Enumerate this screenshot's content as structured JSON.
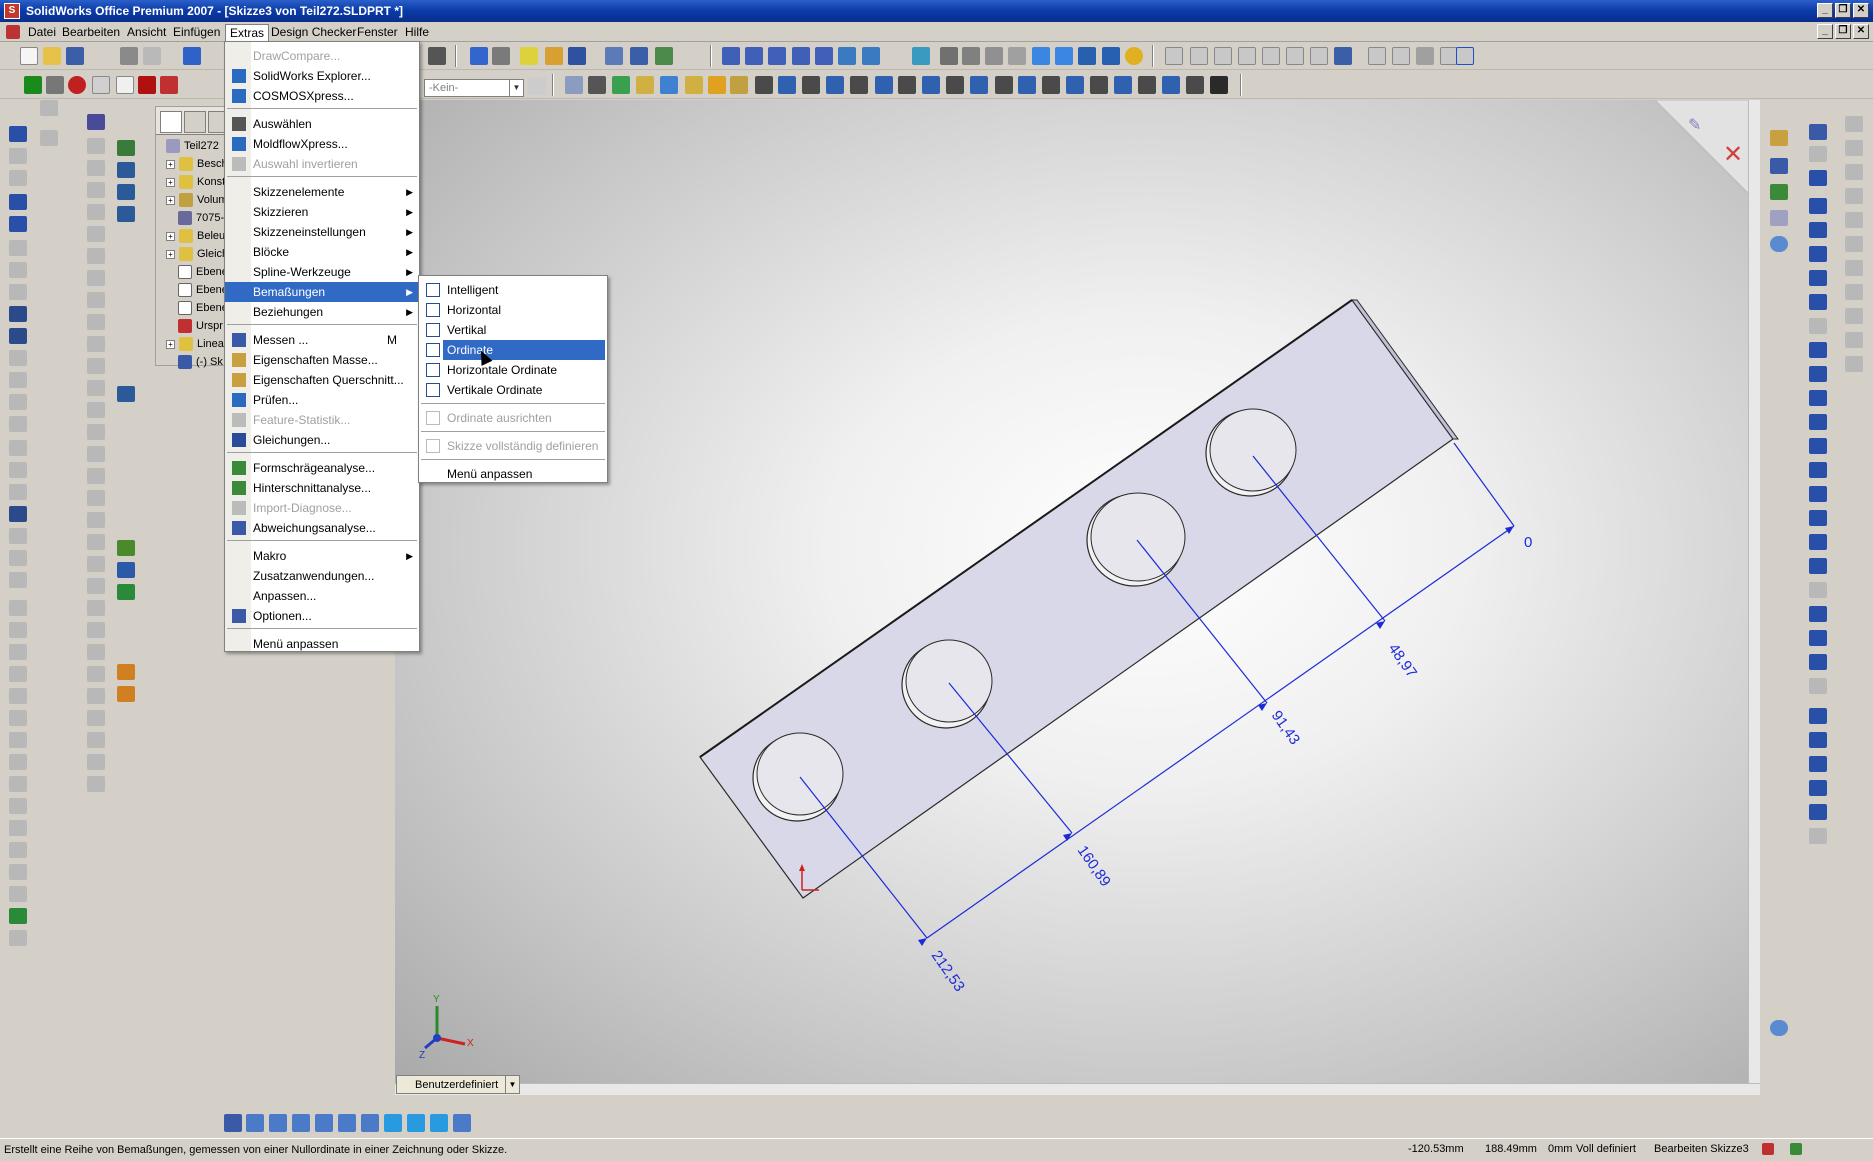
{
  "window": {
    "title": "SolidWorks Office Premium 2007 - [Skizze3 von Teil272.SLDPRT *]",
    "buttons": [
      "_",
      "❐",
      "✕"
    ]
  },
  "menubar": {
    "items": [
      "Datei",
      "Bearbeiten",
      "Ansicht",
      "Einfügen",
      "Extras",
      "Design Checker",
      "Fenster",
      "Hilfe"
    ],
    "active": "Extras"
  },
  "toolbar": {
    "config_dropdown": "-Kein-"
  },
  "feature_tree": {
    "root": "Teil272",
    "items": [
      "Besch",
      "Konst",
      "Volum",
      "7075-",
      "Beleu",
      "Gleich",
      "Ebene",
      "Ebene",
      "Ebene",
      "Urspr",
      "Linea",
      "(-) Sk"
    ]
  },
  "extras_menu": {
    "items": [
      {
        "label": "DrawCompare...",
        "disabled": true
      },
      {
        "label": "SolidWorks Explorer...",
        "disabled": false
      },
      {
        "label": "COSMOSXpress...",
        "disabled": false
      },
      {
        "label": "Auswählen",
        "disabled": false
      },
      {
        "label": "MoldflowXpress...",
        "disabled": false
      },
      {
        "label": "Auswahl invertieren",
        "disabled": true
      },
      {
        "label": "Skizzenelemente",
        "disabled": false,
        "submenu": true
      },
      {
        "label": "Skizzieren",
        "disabled": false,
        "submenu": true
      },
      {
        "label": "Skizzeneinstellungen",
        "disabled": false,
        "submenu": true
      },
      {
        "label": "Blöcke",
        "disabled": false,
        "submenu": true
      },
      {
        "label": "Spline-Werkzeuge",
        "disabled": false,
        "submenu": true
      },
      {
        "label": "Bemaßungen",
        "disabled": false,
        "submenu": true,
        "highlight": true
      },
      {
        "label": "Beziehungen",
        "disabled": false,
        "submenu": true
      },
      {
        "label": "Messen ...",
        "disabled": false,
        "shortcut": "M"
      },
      {
        "label": "Eigenschaften Masse...",
        "disabled": false
      },
      {
        "label": "Eigenschaften Querschnitt...",
        "disabled": false
      },
      {
        "label": "Prüfen...",
        "disabled": false
      },
      {
        "label": "Feature-Statistik...",
        "disabled": true
      },
      {
        "label": "Gleichungen...",
        "disabled": false
      },
      {
        "label": "Formschrägeanalyse...",
        "disabled": false
      },
      {
        "label": "Hinterschnittanalyse...",
        "disabled": false
      },
      {
        "label": "Import-Diagnose...",
        "disabled": true
      },
      {
        "label": "Abweichungsanalyse...",
        "disabled": false
      },
      {
        "label": "Makro",
        "disabled": false,
        "submenu": true
      },
      {
        "label": "Zusatzanwendungen...",
        "disabled": false
      },
      {
        "label": "Anpassen...",
        "disabled": false
      },
      {
        "label": "Optionen...",
        "disabled": false
      },
      {
        "label": "Menü anpassen",
        "disabled": false
      }
    ]
  },
  "dimensions_submenu": {
    "items": [
      {
        "label": "Intelligent",
        "disabled": false
      },
      {
        "label": "Horizontal",
        "disabled": false
      },
      {
        "label": "Vertikal",
        "disabled": false
      },
      {
        "label": "Ordinate",
        "disabled": false,
        "highlight": true
      },
      {
        "label": "Horizontale Ordinate",
        "disabled": false
      },
      {
        "label": "Vertikale Ordinate",
        "disabled": false
      },
      {
        "label": "Ordinate ausrichten",
        "disabled": true
      },
      {
        "label": "Skizze vollständig definieren",
        "disabled": true
      },
      {
        "label": "Menü anpassen",
        "disabled": false
      }
    ]
  },
  "viewport": {
    "dimensions": [
      "0",
      "48,97",
      "91,43",
      "160,89",
      "212,53"
    ],
    "view_orientation": "Benutzerdefiniert",
    "triad": {
      "x": "X",
      "y": "Y",
      "z": "Z"
    }
  },
  "statusbar": {
    "message": "Erstellt eine Reihe von Bemaßungen, gemessen von einer Nullordinate in einer Zeichnung oder Skizze.",
    "x_coord": "-120.53mm",
    "y_coord": "188.49mm",
    "z_coord": "0mm",
    "state": "Voll definiert",
    "mode": "Bearbeiten Skizze3"
  },
  "colors": {
    "title_blue": "#0a3aa8",
    "highlight": "#316ac5",
    "dimension_blue": "#1c2bd8",
    "part_face": "#d9d9e6"
  }
}
